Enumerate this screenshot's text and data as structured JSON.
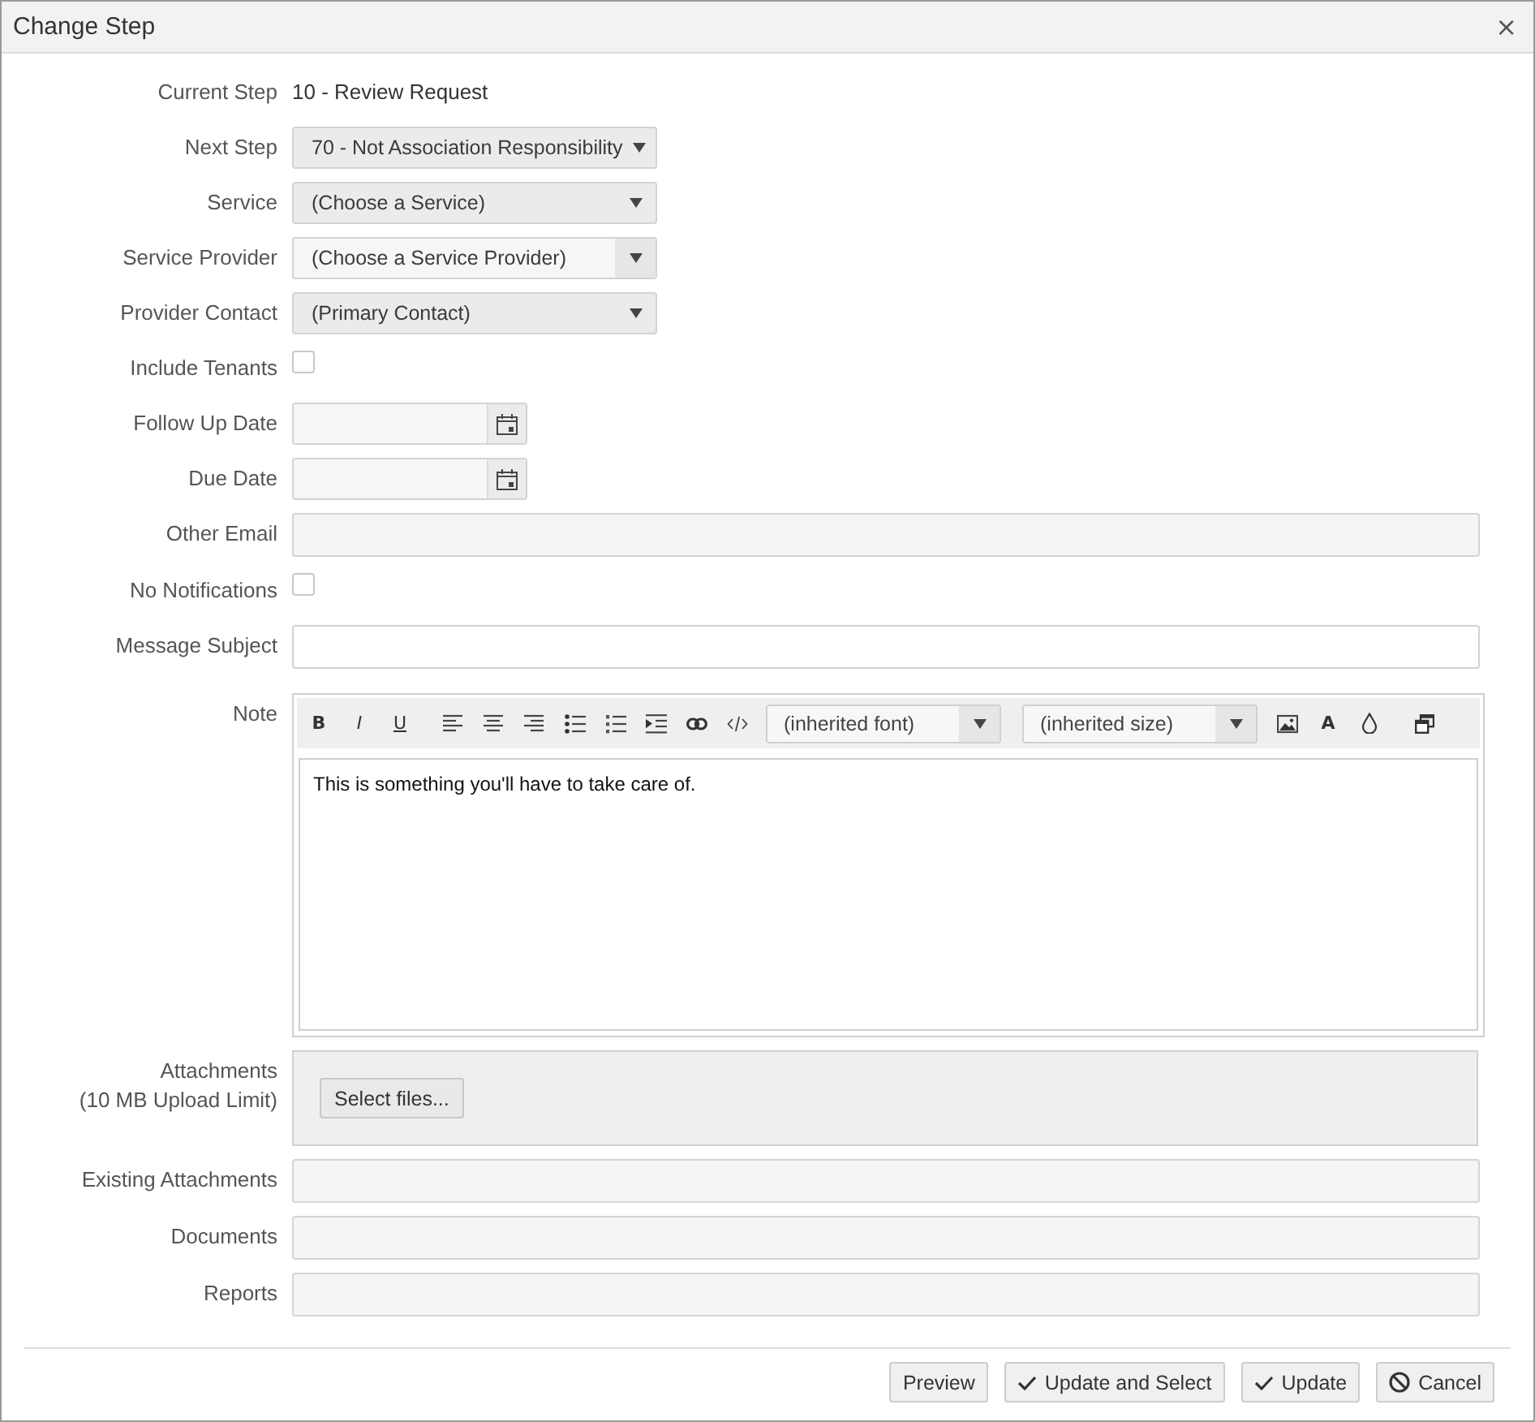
{
  "dialog": {
    "title": "Change Step",
    "close": "×"
  },
  "fields": [
    {
      "kind": "text",
      "label": "Current Step",
      "value": "10 - Review Request"
    },
    {
      "kind": "select",
      "label": "Next Step",
      "value": "70 - Not Association Responsibility"
    },
    {
      "kind": "select",
      "label": "Service",
      "value": "(Choose a Service)"
    },
    {
      "kind": "combobox",
      "label": "Service Provider",
      "value": "(Choose a Service Provider)"
    },
    {
      "kind": "select",
      "label": "Provider Contact",
      "value": "(Primary Contact)"
    },
    {
      "kind": "checkbox",
      "label": "Include Tenants",
      "checked": false
    },
    {
      "kind": "date",
      "label": "Follow Up Date"
    },
    {
      "kind": "date",
      "label": "Due Date"
    },
    {
      "kind": "multiselect",
      "label": "Other Email"
    },
    {
      "kind": "checkbox",
      "label": "No Notifications",
      "checked": false
    },
    {
      "kind": "input",
      "label": "Message Subject"
    },
    {
      "kind": "editor",
      "label": "Note",
      "toolbar": {
        "format": [
          "B",
          "I",
          "U"
        ],
        "font": "(inherited font)",
        "size": "(inherited size)",
        "font_color_glyph": "A"
      },
      "content": "This is something you'll have to take care of."
    },
    {
      "kind": "upload",
      "label": "Attachments",
      "note": "(10 MB Upload Limit)",
      "button": "Select files..."
    },
    {
      "kind": "list",
      "label": "Existing Attachments"
    },
    {
      "kind": "list",
      "label": "Documents"
    },
    {
      "kind": "list",
      "label": "Reports"
    }
  ],
  "buttons": [
    {
      "kind": "plain",
      "label": "Preview"
    },
    {
      "kind": "check",
      "label": "Update and Select"
    },
    {
      "kind": "check",
      "label": "Update"
    },
    {
      "kind": "cancel",
      "label": "Cancel"
    }
  ]
}
